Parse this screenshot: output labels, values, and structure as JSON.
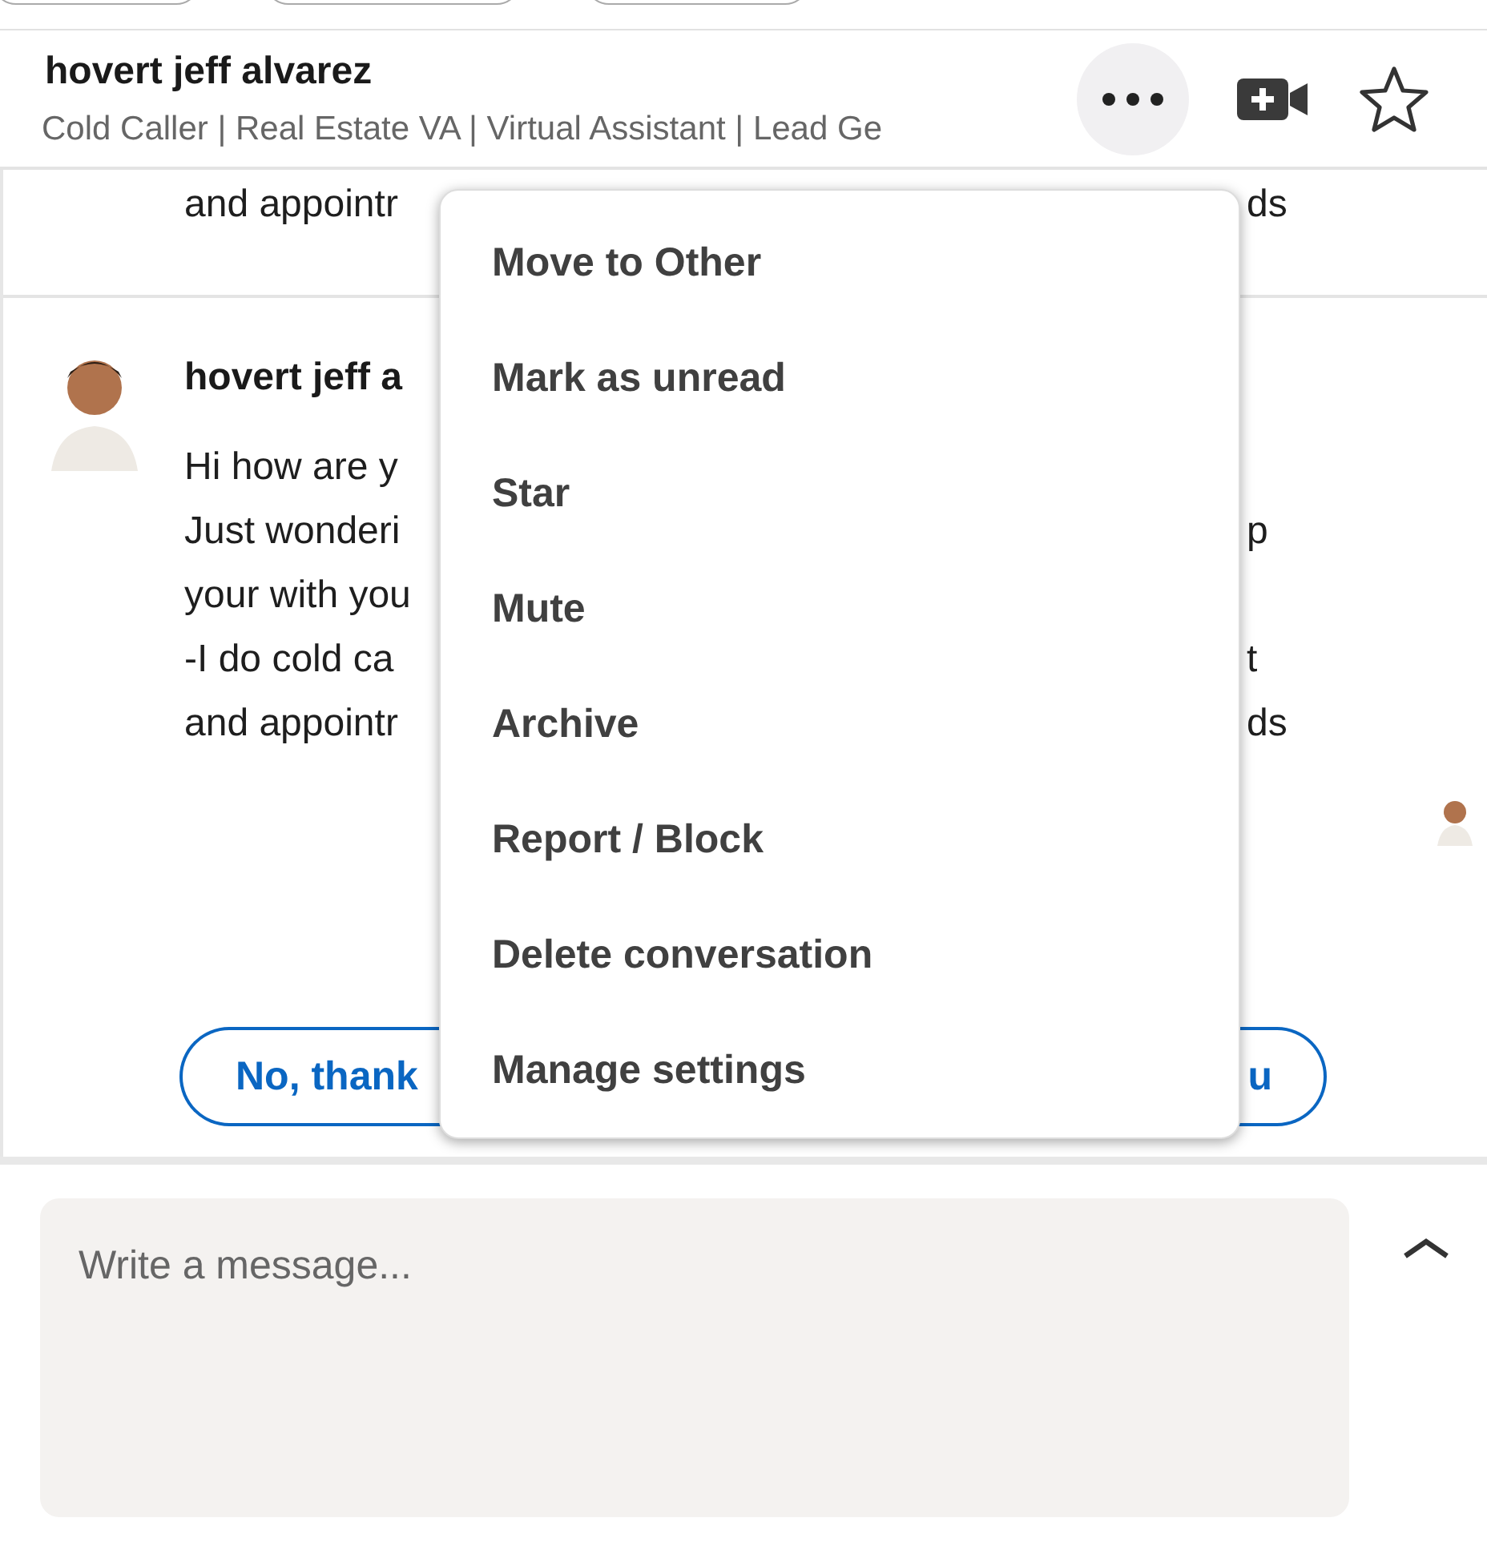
{
  "header": {
    "name": "hovert jeff alvarez",
    "headline": "Cold Caller | Real Estate VA | Virtual Assistant | Lead Ge"
  },
  "previous_message": {
    "lines": [
      {
        "left": "and appointr",
        "right": "ds"
      }
    ]
  },
  "message": {
    "sender": "hovert jeff a",
    "lines": [
      {
        "left": "Hi how are y"
      },
      {
        "left": "Just wonderi",
        "right": "p"
      },
      {
        "left": "your with you"
      },
      {
        "left": "-I do cold ca",
        "right": "t"
      },
      {
        "left": "and appointr",
        "right": "ds"
      }
    ]
  },
  "quick_replies": [
    {
      "text": "No, thank"
    },
    {
      "text": "u"
    }
  ],
  "menu": {
    "items": [
      {
        "label": "Move to Other"
      },
      {
        "label": "Mark as unread"
      },
      {
        "label": "Star"
      },
      {
        "label": "Mute"
      },
      {
        "label": "Archive"
      },
      {
        "label": "Report / Block"
      },
      {
        "label": "Delete conversation"
      },
      {
        "label": "Manage settings"
      }
    ]
  },
  "composer": {
    "placeholder": "Write a message..."
  }
}
